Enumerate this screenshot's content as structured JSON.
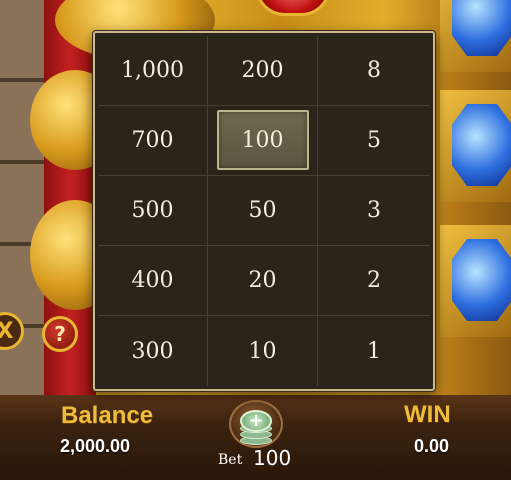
{
  "bet_options": {
    "col1": [
      "1,000",
      "700",
      "500",
      "400",
      "300"
    ],
    "col2": [
      "200",
      "100",
      "50",
      "20",
      "10"
    ],
    "col3": [
      "8",
      "5",
      "3",
      "2",
      "1"
    ],
    "selected": "100"
  },
  "bottom_bar": {
    "balance_label": "Balance",
    "balance_value": "2,000.00",
    "win_label": "WIN",
    "win_value": "0.00",
    "bet_label": "Bet",
    "bet_value": "100",
    "bet_icon": "coin-stack-plus-icon",
    "plus_glyph": "+"
  },
  "side_buttons": {
    "autoplay_icon": "autoplay-icon",
    "autoplay_glyph": "X",
    "help_icon": "help-icon",
    "help_glyph": "?"
  },
  "colors": {
    "gold_label": "#f0bd3a",
    "panel_bg": "#2b241b",
    "panel_border": "#cbb78c",
    "selected_bg": "#5a5640"
  }
}
